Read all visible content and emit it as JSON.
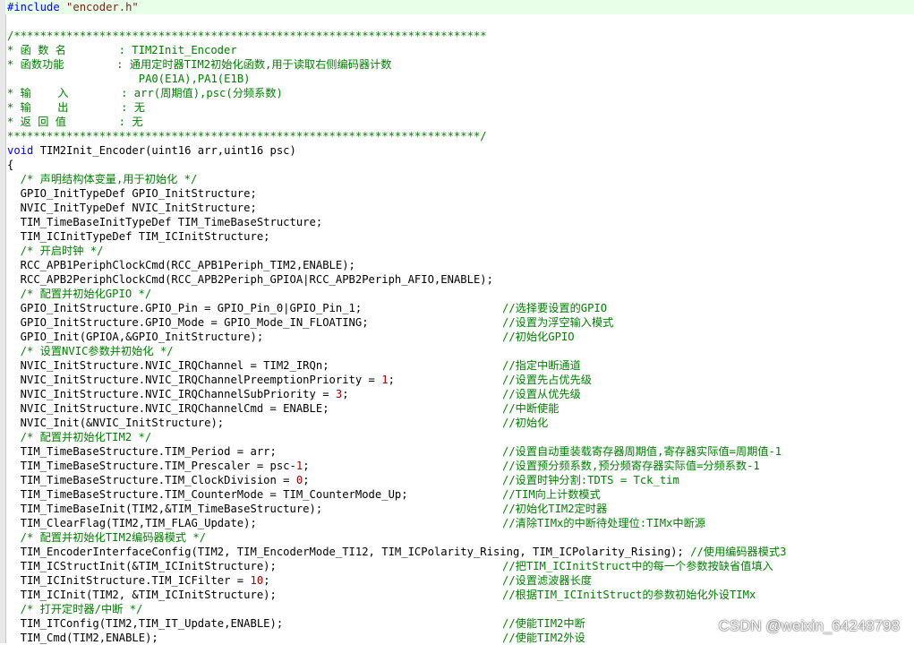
{
  "code": {
    "include_directive": "#include",
    "include_file": "\"encoder.h\"",
    "border_top": "/************************************************************************",
    "header": [
      {
        "key": "* 函 数 名        ",
        "value": ": TIM2Init_Encoder"
      },
      {
        "key": "* 函数功能        ",
        "value": ": 通用定时器TIM2初始化函数,用于读取右侧编码器计数"
      },
      {
        "key": "                   ",
        "value": " PA0(E1A),PA1(E1B)"
      },
      {
        "key": "* 输    入        ",
        "value": ": arr(周期值),psc(分频系数)"
      },
      {
        "key": "* 输    出        ",
        "value": ": 无"
      },
      {
        "key": "* 返 回 值        ",
        "value": ": 无"
      }
    ],
    "border_bottom": "************************************************************************/",
    "func_keyword": "void",
    "func_signature": " TIM2Init_Encoder(uint16 arr,uint16 psc)",
    "open_brace": "{",
    "body": [
      {
        "c": "  /* 声明结构体变量,用于初始化 */"
      },
      {
        "t": "  GPIO_InitTypeDef GPIO_InitStructure;"
      },
      {
        "t": "  NVIC_InitTypeDef NVIC_InitStructure;"
      },
      {
        "t": "  TIM_TimeBaseInitTypeDef TIM_TimeBaseStructure;"
      },
      {
        "t": "  TIM_ICInitTypeDef TIM_ICInitStructure;"
      },
      {
        "c": "  /* 开启时钟 */"
      },
      {
        "t": "  RCC_APB1PeriphClockCmd(RCC_APB1Periph_TIM2,ENABLE);"
      },
      {
        "t": "  RCC_APB2PeriphClockCmd(RCC_APB2Periph_GPIOA|RCC_APB2Periph_AFIO,ENABLE);"
      },
      {
        "c": "  /* 配置并初始化GPIO */"
      },
      {
        "t": "  GPIO_InitStructure.GPIO_Pin = GPIO_Pin_0|GPIO_Pin_1;",
        "tc": "//选择要设置的GPIO"
      },
      {
        "t": "  GPIO_InitStructure.GPIO_Mode = GPIO_Mode_IN_FLOATING;",
        "tc": "//设置为浮空输入模式"
      },
      {
        "t": "  GPIO_Init(GPIOA,&GPIO_InitStructure);",
        "tc": "//初始化GPIO"
      },
      {
        "c": "  /* 设置NVIC参数并初始化 */"
      },
      {
        "t": "  NVIC_InitStructure.NVIC_IRQChannel = TIM2_IRQn;",
        "tc": "//指定中断通道"
      },
      {
        "t": "  NVIC_InitStructure.NVIC_IRQChannelPreemptionPriority = ",
        "n": "1",
        "t2": ";",
        "tc": "//设置先占优先级"
      },
      {
        "t": "  NVIC_InitStructure.NVIC_IRQChannelSubPriority = ",
        "n": "3",
        "t2": ";",
        "tc": "//设置从优先级"
      },
      {
        "t": "  NVIC_InitStructure.NVIC_IRQChannelCmd = ENABLE;",
        "tc": "//中断使能"
      },
      {
        "t": "  NVIC_Init(&NVIC_InitStructure);",
        "tc": "//初始化"
      },
      {
        "c": "  /* 配置并初始化TIM2 */"
      },
      {
        "t": "  TIM_TimeBaseStructure.TIM_Period = arr;",
        "tc": "//设置自动重装载寄存器周期值,寄存器实际值=周期值-1"
      },
      {
        "t": "  TIM_TimeBaseStructure.TIM_Prescaler = psc-",
        "n": "1",
        "t2": ";",
        "tc": "//设置预分频系数,预分频寄存器实际值=分频系数-1"
      },
      {
        "t": "  TIM_TimeBaseStructure.TIM_ClockDivision = ",
        "n": "0",
        "t2": ";",
        "tc": "//设置时钟分割:TDTS = Tck_tim"
      },
      {
        "t": "  TIM_TimeBaseStructure.TIM_CounterMode = TIM_CounterMode_Up;",
        "tc": "//TIM向上计数模式"
      },
      {
        "t": "  TIM_TimeBaseInit(TIM2,&TIM_TimeBaseStructure);",
        "tc": "//初始化TIM2定时器"
      },
      {
        "t": "  TIM_ClearFlag(TIM2,TIM_FLAG_Update);",
        "tc": "//清除TIMx的中断待处理位:TIMx中断源"
      },
      {
        "c": "  /* 配置并初始化TIM2编码器模式 */"
      },
      {
        "t": "  TIM_EncoderInterfaceConfig(TIM2, TIM_EncoderMode_TI12, TIM_ICPolarity_Rising, TIM_ICPolarity_Rising); ",
        "c2": "//使用编码器模式3"
      },
      {
        "t": "  TIM_ICStructInit(&TIM_ICInitStructure);",
        "tc": "//把TIM_ICInitStruct中的每一个参数按缺省值填入"
      },
      {
        "t": "  TIM_ICInitStructure.TIM_ICFilter = ",
        "n": "10",
        "t2": ";",
        "tc": "//设置滤波器长度"
      },
      {
        "t": "  TIM_ICInit(TIM2, &TIM_ICInitStructure);",
        "tc": "//根据TIM_ICInitStruct的参数初始化外设TIMx"
      },
      {
        "c": "  /* 打开定时器/中断 */"
      },
      {
        "t": "  TIM_ITConfig(TIM2,TIM_IT_Update,ENABLE);",
        "tc": "//使能TIM2中断"
      },
      {
        "t": "  TIM_Cmd(TIM2,ENABLE);",
        "tc": "//使能TIM2外设"
      }
    ]
  },
  "watermark": "CSDN @weixin_64248798"
}
